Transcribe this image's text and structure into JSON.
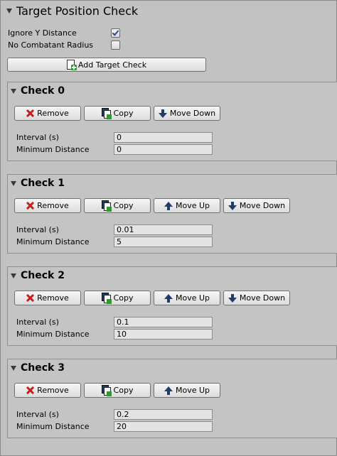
{
  "header": {
    "title": "Target Position Check"
  },
  "toggles": [
    {
      "label": "Ignore Y Distance",
      "checked": true
    },
    {
      "label": "No Combatant Radius",
      "checked": false
    }
  ],
  "add_button_label": "Add Target Check",
  "checks": [
    {
      "title": "Check 0",
      "remove": "Remove",
      "copy": "Copy",
      "move_up": "",
      "move_down": "Move Down",
      "interval_label": "Interval (s)",
      "interval": "0",
      "mindist_label": "Minimum Distance",
      "mindist": "0"
    },
    {
      "title": "Check 1",
      "remove": "Remove",
      "copy": "Copy",
      "move_up": "Move Up",
      "move_down": "Move Down",
      "interval_label": "Interval (s)",
      "interval": "0.01",
      "mindist_label": "Minimum Distance",
      "mindist": "5"
    },
    {
      "title": "Check 2",
      "remove": "Remove",
      "copy": "Copy",
      "move_up": "Move Up",
      "move_down": "Move Down",
      "interval_label": "Interval (s)",
      "interval": "0.1",
      "mindist_label": "Minimum Distance",
      "mindist": "10"
    },
    {
      "title": "Check 3",
      "remove": "Remove",
      "copy": "Copy",
      "move_up": "Move Up",
      "move_down": "",
      "interval_label": "Interval (s)",
      "interval": "0.2",
      "mindist_label": "Minimum Distance",
      "mindist": "20"
    }
  ]
}
